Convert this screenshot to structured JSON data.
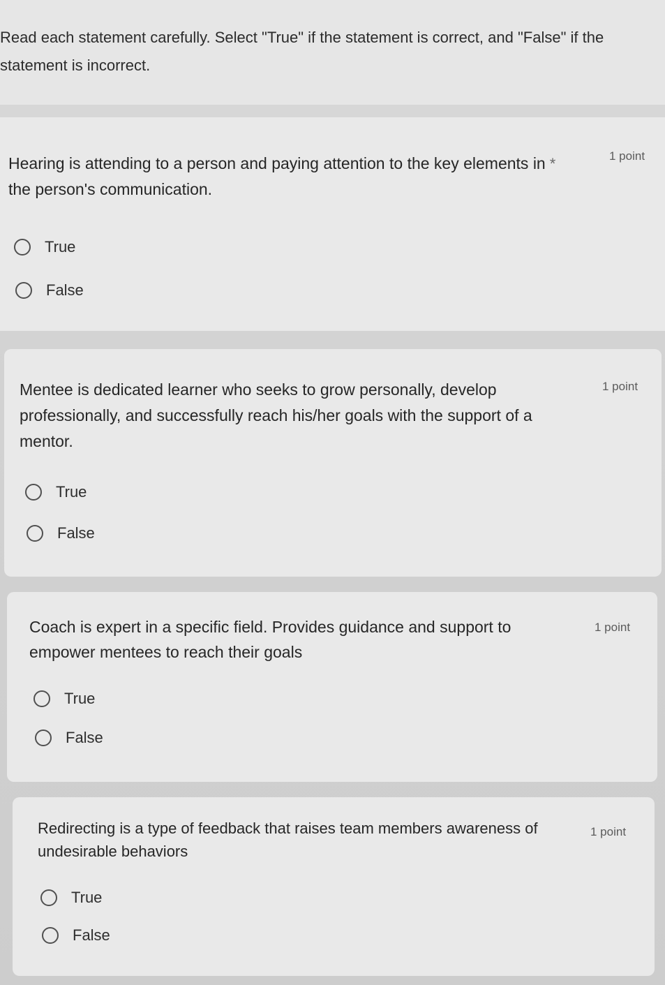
{
  "instructions": {
    "line1": "Read each statement carefully. Select \"True\" if the statement is correct, and \"False\" if the",
    "line2": "statement is incorrect."
  },
  "questions": [
    {
      "text_line1": "Hearing is attending to a person and paying attention to the key elements in",
      "text_line2": "the person's communication.",
      "required_mark": "*",
      "points": "1 point",
      "options": [
        "True",
        "False"
      ]
    },
    {
      "text_line1": "Mentee is dedicated learner who seeks to grow personally, develop",
      "text_line2": "professionally, and successfully reach his/her  goals with the support of a",
      "text_line3": "mentor.",
      "points": "1 point",
      "options": [
        "True",
        "False"
      ]
    },
    {
      "text_line1": "Coach is expert in a specific field. Provides guidance and support to",
      "text_line2": "empower mentees to reach their goals",
      "points": "1 point",
      "options": [
        "True",
        "False"
      ]
    },
    {
      "text_line1": "Redirecting is a type of feedback that raises team members awareness of",
      "text_line2": "undesirable behaviors",
      "points": "1 point",
      "options": [
        "True",
        "False"
      ]
    }
  ]
}
